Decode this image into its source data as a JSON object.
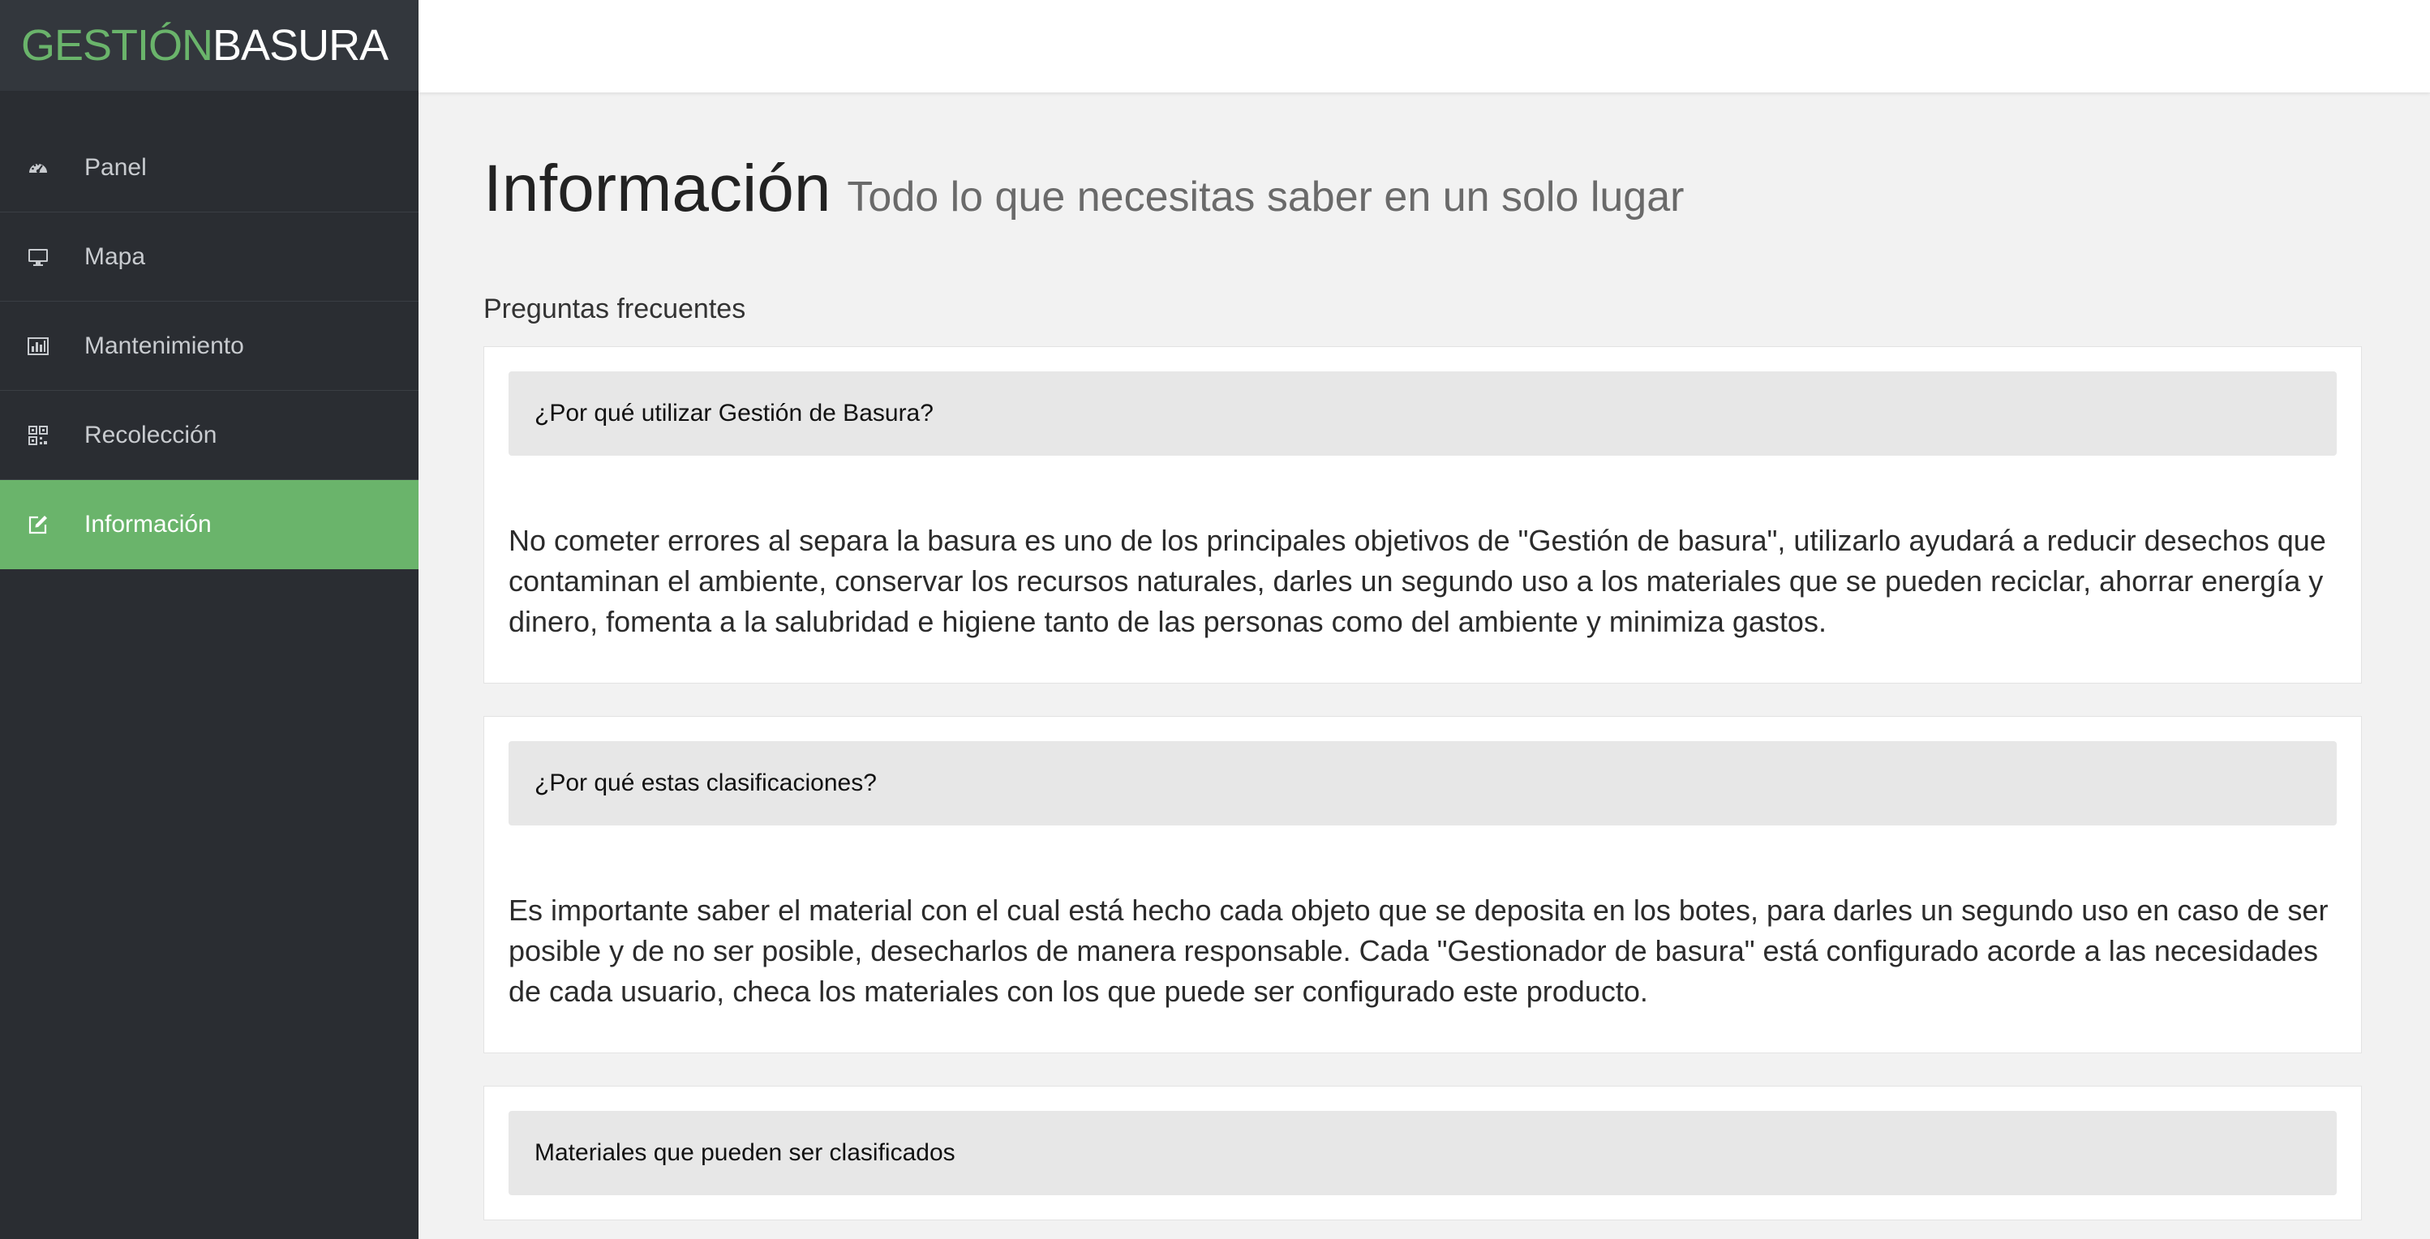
{
  "brand": {
    "part1": "GESTIÓN",
    "part2": "BASURA"
  },
  "sidebar": {
    "items": [
      {
        "label": "Panel",
        "icon": "dashboard-icon",
        "active": false
      },
      {
        "label": "Mapa",
        "icon": "monitor-icon",
        "active": false
      },
      {
        "label": "Mantenimiento",
        "icon": "bar-chart-icon",
        "active": false
      },
      {
        "label": "Recolección",
        "icon": "qrcode-icon",
        "active": false
      },
      {
        "label": "Información",
        "icon": "edit-icon",
        "active": true
      }
    ]
  },
  "page": {
    "title": "Información",
    "subtitle": "Todo lo que necesitas saber en un solo lugar",
    "section_label": "Preguntas frecuentes"
  },
  "faq": [
    {
      "question": "¿Por qué utilizar Gestión de Basura?",
      "answer": "No cometer errores al separa la basura es uno de los principales objetivos de \"Gestión de basura\", utilizarlo ayudará a reducir desechos que contaminan el ambiente, conservar los recursos naturales, darles un segundo uso a los materiales que se pueden reciclar, ahorrar energía y dinero, fomenta a la salubridad e higiene tanto de las personas como del ambiente y minimiza gastos."
    },
    {
      "question": "¿Por qué estas clasificaciones?",
      "answer": "Es importante saber el material con el cual está hecho cada objeto que se deposita en los botes, para darles un segundo uso en caso de ser posible y de no ser posible, desecharlos de manera responsable. Cada \"Gestionador de basura\" está configurado acorde a las necesidades de cada usuario, checa los materiales con los que puede ser configurado este producto."
    },
    {
      "question": "Materiales que pueden ser clasificados",
      "answer": ""
    }
  ],
  "colors": {
    "accent": "#6ab46b",
    "sidebar_bg": "#2a2d32",
    "brand_bg": "#33373d",
    "page_bg": "#f2f2f2"
  }
}
